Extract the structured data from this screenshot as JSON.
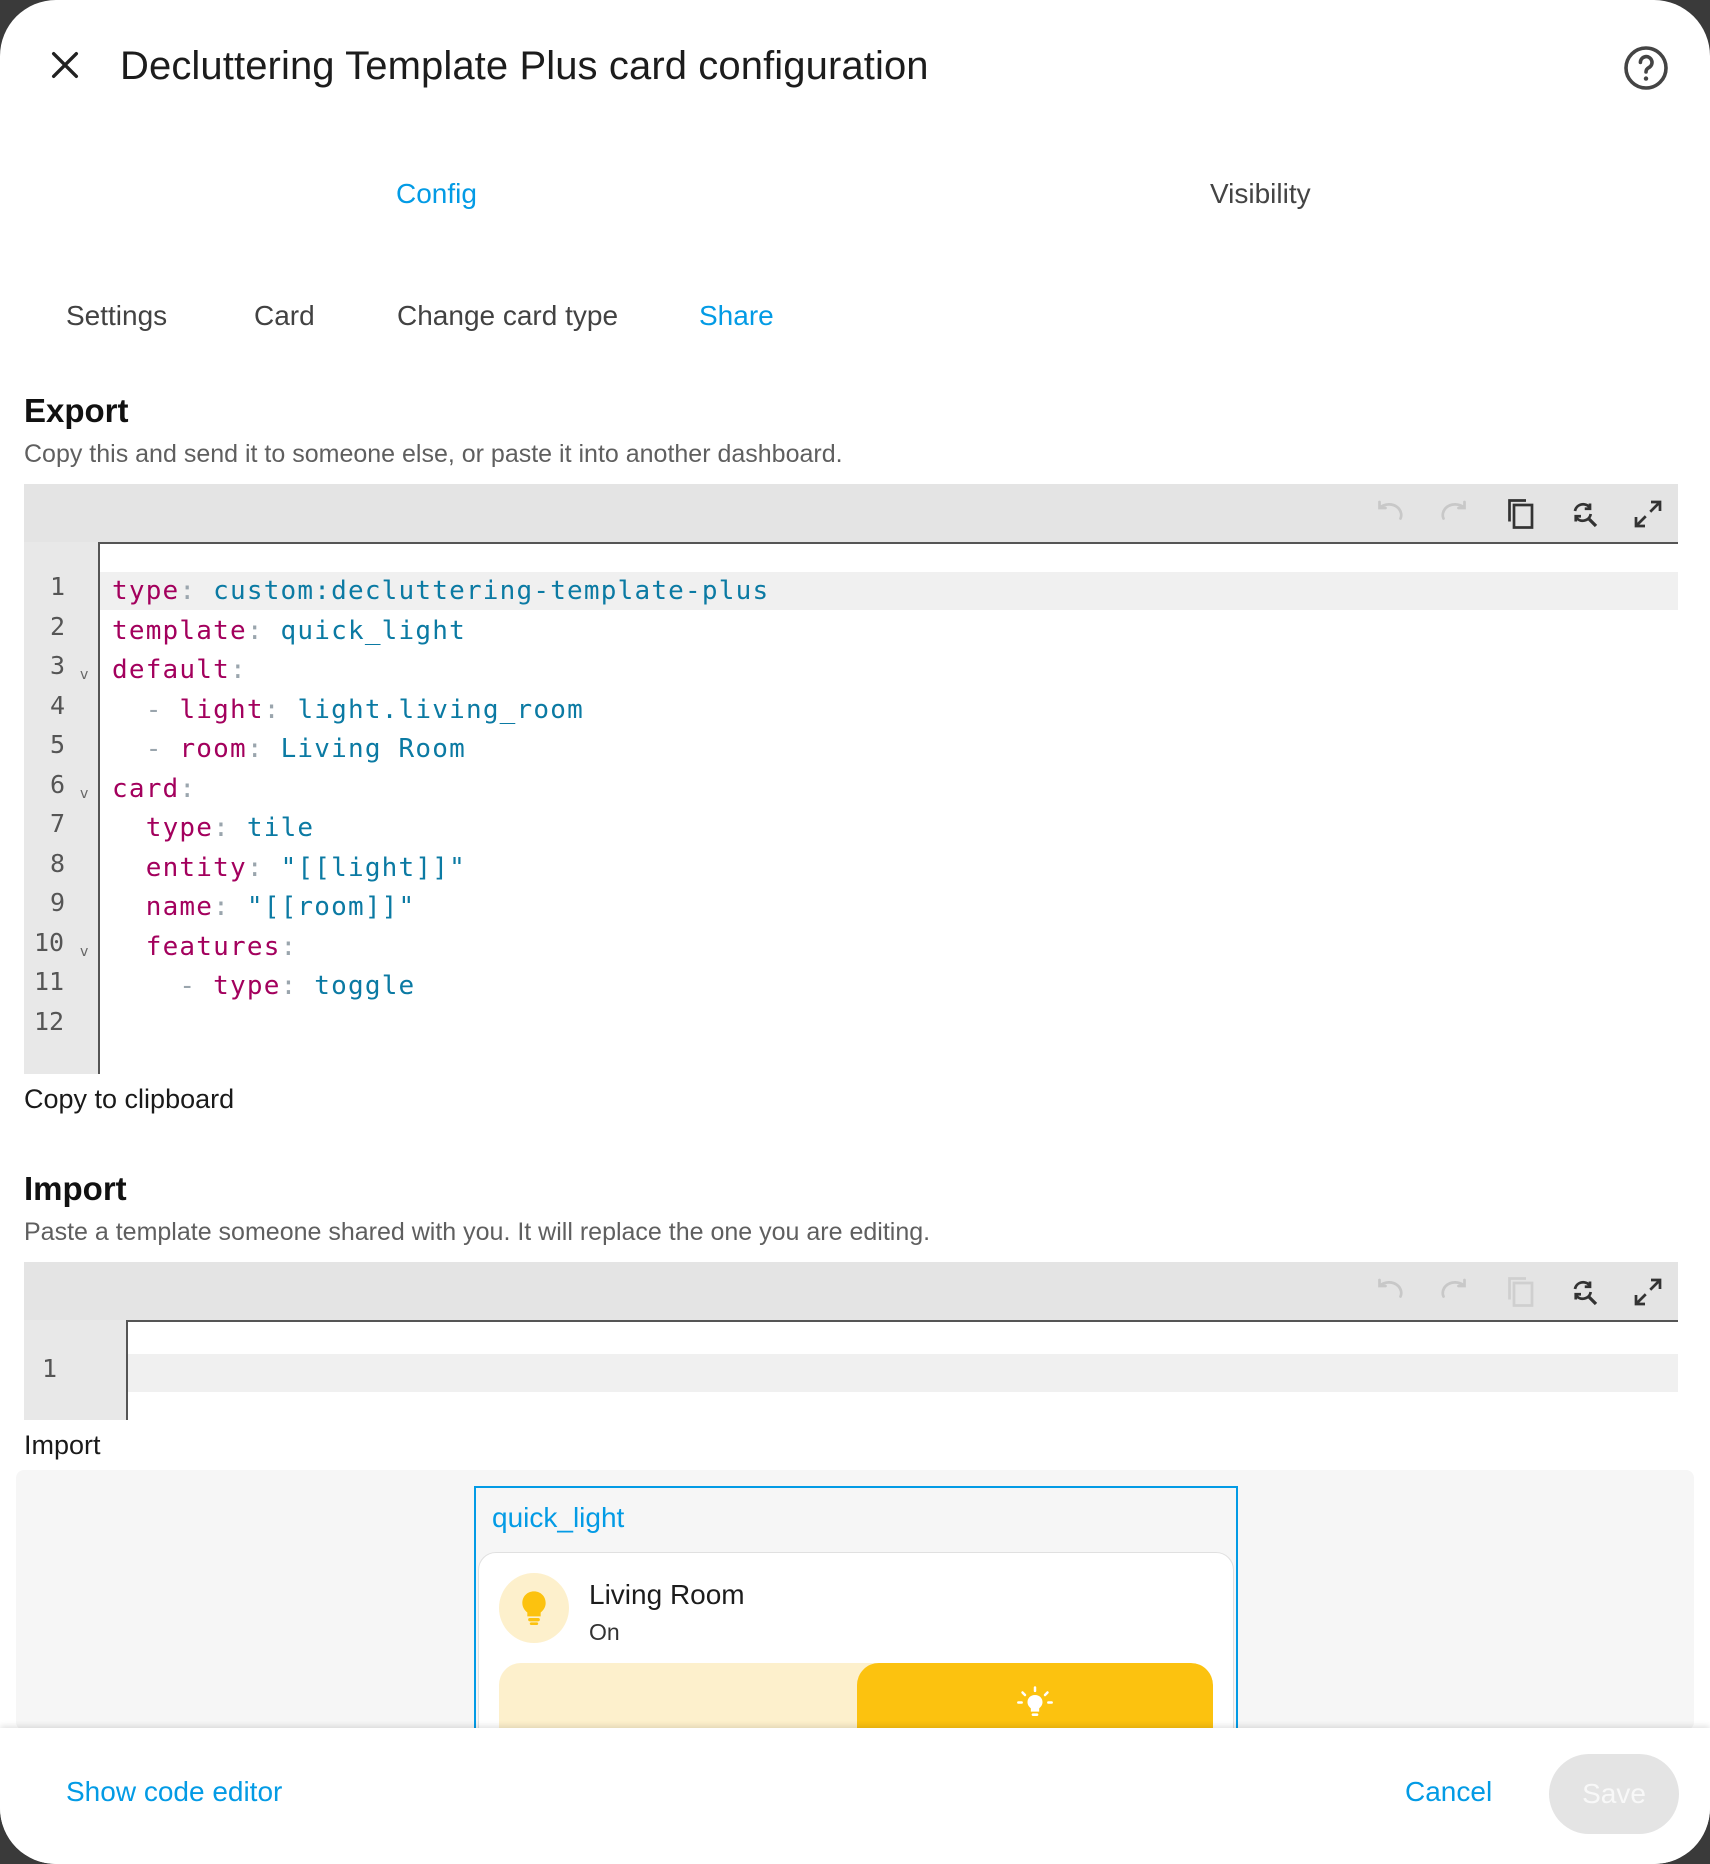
{
  "dialog": {
    "title": "Decluttering Template Plus card configuration"
  },
  "tabs_top": [
    {
      "label": "Config",
      "active": true
    },
    {
      "label": "Visibility",
      "active": false
    }
  ],
  "tabs_sub": [
    {
      "label": "Settings",
      "active": false
    },
    {
      "label": "Card",
      "active": false
    },
    {
      "label": "Change card type",
      "active": false
    },
    {
      "label": "Share",
      "active": true
    }
  ],
  "export": {
    "heading": "Export",
    "description": "Copy this and send it to someone else, or paste it into another dashboard.",
    "copy_label": "Copy to clipboard",
    "line_numbers": [
      "1",
      "2",
      "3",
      "4",
      "5",
      "6",
      "7",
      "8",
      "9",
      "10",
      "11",
      "12"
    ],
    "code_lines": [
      {
        "indent": "",
        "dash": false,
        "key": "type",
        "value": "custom:decluttering-template-plus"
      },
      {
        "indent": "",
        "dash": false,
        "key": "template",
        "value": "quick_light"
      },
      {
        "indent": "",
        "dash": false,
        "key": "default",
        "value": ""
      },
      {
        "indent": "  ",
        "dash": true,
        "key": "light",
        "value": "light.living_room"
      },
      {
        "indent": "  ",
        "dash": true,
        "key": "room",
        "value": "Living Room"
      },
      {
        "indent": "",
        "dash": false,
        "key": "card",
        "value": ""
      },
      {
        "indent": "  ",
        "dash": false,
        "key": "type",
        "value": "tile"
      },
      {
        "indent": "  ",
        "dash": false,
        "key": "entity",
        "value": "\"[[light]]\""
      },
      {
        "indent": "  ",
        "dash": false,
        "key": "name",
        "value": "\"[[room]]\""
      },
      {
        "indent": "  ",
        "dash": false,
        "key": "features",
        "value": ""
      },
      {
        "indent": "    ",
        "dash": true,
        "key": "type",
        "value": "toggle"
      },
      {
        "indent": "",
        "dash": false,
        "key": "",
        "value": ""
      }
    ],
    "fold_lines": [
      3,
      6,
      10
    ]
  },
  "import": {
    "heading": "Import",
    "description": "Paste a template someone shared with you. It will replace the one you are editing.",
    "import_label": "Import",
    "line_numbers": [
      "1"
    ],
    "value": ""
  },
  "preview": {
    "template_name": "quick_light",
    "tile_name": "Living Room",
    "tile_state": "On"
  },
  "footer": {
    "show_code_label": "Show code editor",
    "cancel_label": "Cancel",
    "save_label": "Save"
  },
  "colors": {
    "accent": "#039be5",
    "yaml_key": "#a3005d",
    "yaml_value": "#0b7aa3",
    "light_on": "#fcc20f"
  },
  "icons": {
    "close": "close-icon",
    "help": "help-circle-icon",
    "undo": "undo-icon",
    "redo": "redo-icon",
    "copy": "copy-icon",
    "search": "find-replace-icon",
    "fullscreen": "fullscreen-icon",
    "bulb": "lightbulb-icon"
  }
}
